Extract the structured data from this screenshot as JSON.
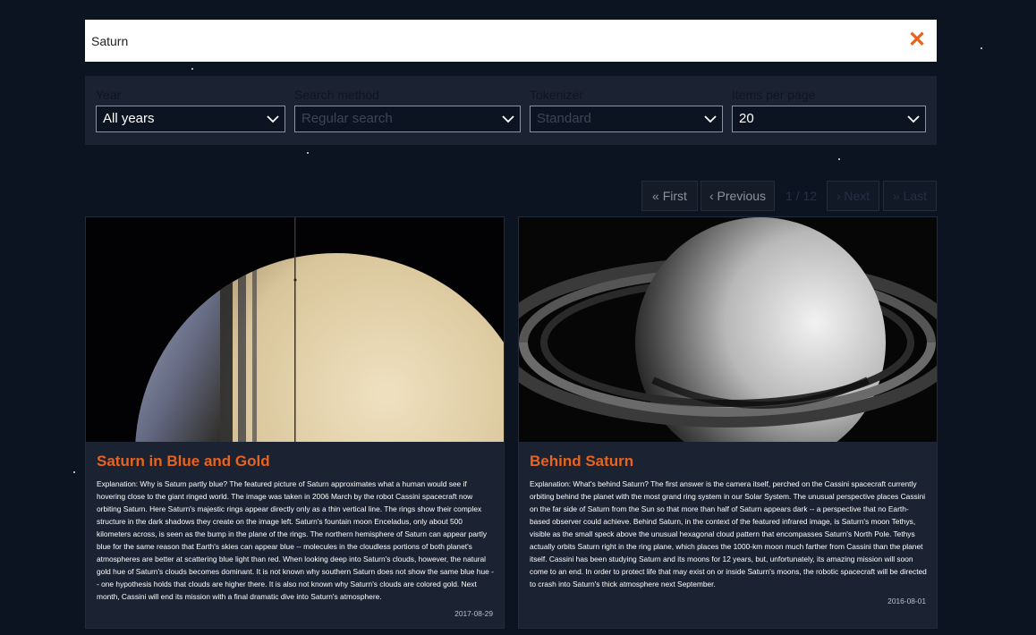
{
  "search": {
    "value": "Saturn",
    "clear_icon": "close-icon",
    "accent": "#e8631e"
  },
  "filters": [
    {
      "label": "Year",
      "value": "All years",
      "disabled": false
    },
    {
      "label": "Search method",
      "value": "Regular search",
      "disabled": true
    },
    {
      "label": "Tokenizer",
      "value": "Standard",
      "disabled": true
    },
    {
      "label": "Items per page",
      "value": "20",
      "disabled": false
    }
  ],
  "pagination": {
    "first": "First",
    "previous": "Previous",
    "page_info": "1 / 12",
    "next": "Next",
    "last": "Last"
  },
  "cards": [
    {
      "title": "Saturn in Blue and Gold",
      "description": "Explanation: Why is Saturn partly blue? The featured picture of Saturn approximates what a human would see if hovering close to the giant ringed world. The image was taken in 2006 March by the robot Cassini spacecraft now orbiting Saturn. Here Saturn's majestic rings appear directly only as a thin vertical line. The rings show their complex structure in the dark shadows they create on the image left. Saturn's fountain moon Enceladus, only about 500 kilometers across, is seen as the bump in the plane of the rings. The northern hemisphere of Saturn can appear partly blue for the same reason that Earth's skies can appear blue -- molecules in the cloudless portions of both planet's atmospheres are better at scattering blue light than red. When looking deep into Saturn's clouds, however, the natural gold hue of Saturn's clouds becomes dominant. It is not known why southern Saturn does not show the same blue hue -- one hypothesis holds that clouds are higher there. It is also not known why Saturn's clouds are colored gold. Next month, Cassini will end its mission with a final dramatic dive into Saturn's atmosphere.",
      "date": "2017-08-29"
    },
    {
      "title": "Behind Saturn",
      "description": "Explanation: What's behind Saturn? The first answer is the camera itself, perched on the Cassini spacecraft currently orbiting behind the planet with the most grand ring system in our Solar System. The unusual perspective places Cassini on the far side of Saturn from the Sun so that more than half of Saturn appears dark -- a perspective that no Earth-based observer could achieve. Behind Saturn, in the context of the featured infrared image, is Saturn's moon Tethys, visible as the small speck above the unusual hexagonal cloud pattern that encompasses Saturn's North Pole. Tethys actually orbits Saturn right in the ring plane, which places the 1000-km moon much farther from Cassini than the planet itself. Cassini has been studying Saturn and its moons for 12 years, but, unfortunately, its amazing mission will soon come to an end. In order to protect life that may exist on or inside Saturn's moons, the robotic spacecraft will be directed to crash into Saturn's thick atmosphere next September.",
      "date": "2016-08-01"
    }
  ]
}
